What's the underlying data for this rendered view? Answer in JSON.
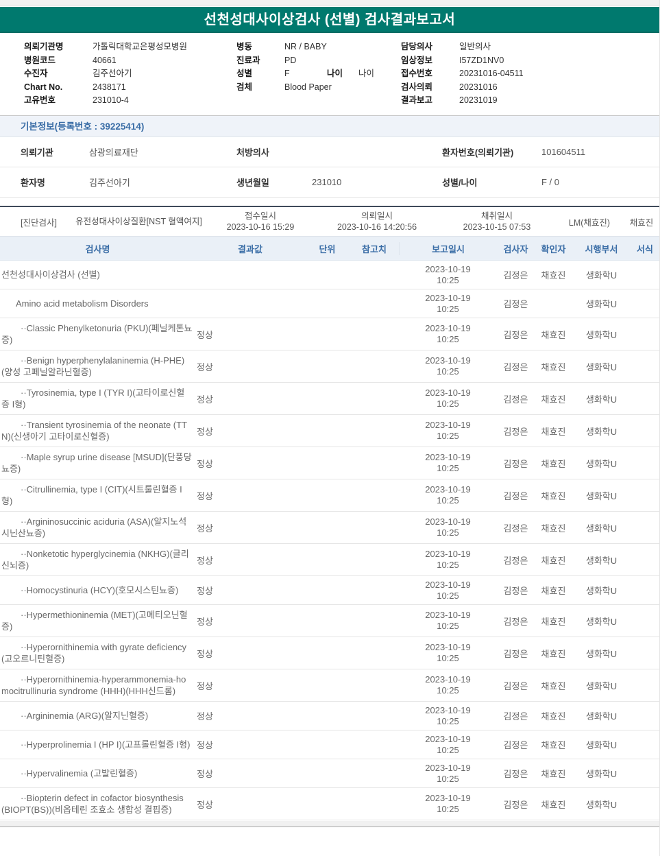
{
  "colors": {
    "banner_teal": "#00796E",
    "accent_blue": "#3A6DA6",
    "table_header_bg": "#EAF0F7",
    "section_header_bg": "#EFF3F9"
  },
  "banner": {
    "title": "선천성대사이상검사 (선별) 검사결과보고서"
  },
  "patient_header": {
    "left": [
      {
        "label": "의뢰기관명",
        "value": "가톨릭대학교은평성모병원"
      },
      {
        "label": "병원코드",
        "value": "40661"
      },
      {
        "label": "수진자",
        "value": "김주선아기"
      },
      {
        "label": "Chart No.",
        "value": "2438171"
      },
      {
        "label": "고유번호",
        "value": "231010-4"
      }
    ],
    "middle": [
      {
        "label": "병동",
        "value": "NR / BABY"
      },
      {
        "label": "진료과",
        "value": "PD"
      },
      {
        "label": "성별",
        "value": "F",
        "extra_label": "나이",
        "extra_value": "나이"
      },
      {
        "label": "검체",
        "value": "Blood Paper"
      }
    ],
    "right": [
      {
        "label": "담당의사",
        "value": "일반의사"
      },
      {
        "label": "임상정보",
        "value": "I57ZD1NV0"
      },
      {
        "label": "접수번호",
        "value": "20231016-04511"
      },
      {
        "label": "검사의뢰",
        "value": "20231016"
      },
      {
        "label": "결과보고",
        "value": "20231019"
      }
    ]
  },
  "basic_info": {
    "section_title": "기본정보(등록번호 : 39225414)",
    "rows": [
      [
        {
          "label": "의뢰기관",
          "value": "삼광의료재단"
        },
        {
          "label": "처방의사",
          "value": ""
        },
        {
          "label": "환자번호(의뢰기관)",
          "value": "101604511"
        }
      ],
      [
        {
          "label": "환자명",
          "value": "김주선아기"
        },
        {
          "label": "생년월일",
          "value": "231010"
        },
        {
          "label": "성별/나이",
          "value": "F / 0"
        }
      ]
    ]
  },
  "diagnosis_bar": {
    "tag": "[진단검사]",
    "group_name": "유전성대사이상질환[NST 혈액여지]",
    "received_label": "접수일시",
    "received_value": "2023-10-16 15:29",
    "requested_label": "의뢰일시",
    "requested_value": "2023-10-16 14:20:56",
    "collected_label": "채취일시",
    "collected_value": "2023-10-15 07:53",
    "lab": "LM(채효진)",
    "collector": "채효진"
  },
  "results_table": {
    "headers": {
      "name": "검사명",
      "result": "결과값",
      "unit": "단위",
      "ref": "참고치",
      "report": "보고일시",
      "tester": "검사자",
      "confirmer": "확인자",
      "dept": "시행부서",
      "form": "서식"
    },
    "rows": [
      {
        "name": "선천성대사이상검사 (선별)",
        "level": 0,
        "result": "",
        "report_date": "2023-10-19",
        "report_time": "10:25",
        "tester": "김정은",
        "confirmer": "채효진",
        "dept": "생화학U"
      },
      {
        "name": "Amino acid metabolism Disorders",
        "level": 1,
        "result": "",
        "report_date": "2023-10-19",
        "report_time": "10:25",
        "tester": "김정은",
        "confirmer": "",
        "dept": "생화학U"
      },
      {
        "name": "··Classic Phenylketonuria (PKU)(페닐케톤뇨증)",
        "level": 2,
        "result": "정상",
        "report_date": "2023-10-19",
        "report_time": "10:25",
        "tester": "김정은",
        "confirmer": "채효진",
        "dept": "생화학U"
      },
      {
        "name": "··Benign hyperphenylalaninemia (H-PHE)(양성 고페닐알라닌혈증)",
        "level": 2,
        "result": "정상",
        "report_date": "2023-10-19",
        "report_time": "10:25",
        "tester": "김정은",
        "confirmer": "채효진",
        "dept": "생화학U"
      },
      {
        "name": "··Tyrosinemia, type I (TYR I)(고타이로신혈증 I형)",
        "level": 2,
        "result": "정상",
        "report_date": "2023-10-19",
        "report_time": "10:25",
        "tester": "김정은",
        "confirmer": "채효진",
        "dept": "생화학U"
      },
      {
        "name": "··Transient tyrosinemia of the neonate (TTN)(신생아기 고타이로신혈증)",
        "level": 2,
        "result": "정상",
        "report_date": "2023-10-19",
        "report_time": "10:25",
        "tester": "김정은",
        "confirmer": "채효진",
        "dept": "생화학U"
      },
      {
        "name": "··Maple syrup urine disease [MSUD](단풍당뇨증)",
        "level": 2,
        "result": "정상",
        "report_date": "2023-10-19",
        "report_time": "10:25",
        "tester": "김정은",
        "confirmer": "채효진",
        "dept": "생화학U"
      },
      {
        "name": "··Citrullinemia, type I (CIT)(시트룰린혈증 I형)",
        "level": 2,
        "result": "정상",
        "report_date": "2023-10-19",
        "report_time": "10:25",
        "tester": "김정은",
        "confirmer": "채효진",
        "dept": "생화학U"
      },
      {
        "name": "··Argininosuccinic aciduria (ASA)(알지노석시닌산뇨증)",
        "level": 2,
        "result": "정상",
        "report_date": "2023-10-19",
        "report_time": "10:25",
        "tester": "김정은",
        "confirmer": "채효진",
        "dept": "생화학U"
      },
      {
        "name": "··Nonketotic hyperglycinemia (NKHG)(글리신뇌증)",
        "level": 2,
        "result": "정상",
        "report_date": "2023-10-19",
        "report_time": "10:25",
        "tester": "김정은",
        "confirmer": "채효진",
        "dept": "생화학U"
      },
      {
        "name": "··Homocystinuria (HCY)(호모시스틴뇨증)",
        "level": 2,
        "result": "정상",
        "report_date": "2023-10-19",
        "report_time": "10:25",
        "tester": "김정은",
        "confirmer": "채효진",
        "dept": "생화학U"
      },
      {
        "name": "··Hypermethioninemia (MET)(고메티오닌혈증)",
        "level": 2,
        "result": "정상",
        "report_date": "2023-10-19",
        "report_time": "10:25",
        "tester": "김정은",
        "confirmer": "채효진",
        "dept": "생화학U"
      },
      {
        "name": "··Hyperornithinemia with gyrate deficiency(고오르니틴혈증)",
        "level": 2,
        "result": "정상",
        "report_date": "2023-10-19",
        "report_time": "10:25",
        "tester": "김정은",
        "confirmer": "채효진",
        "dept": "생화학U"
      },
      {
        "name": "··Hyperornithinemia-hyperammonemia-homocitrullinuria syndrome (HHH)(HHH신드롬)",
        "level": 2,
        "result": "정상",
        "report_date": "2023-10-19",
        "report_time": "10:25",
        "tester": "김정은",
        "confirmer": "채효진",
        "dept": "생화학U"
      },
      {
        "name": "··Argininemia (ARG)(알지닌혈증)",
        "level": 2,
        "result": "정상",
        "report_date": "2023-10-19",
        "report_time": "10:25",
        "tester": "김정은",
        "confirmer": "채효진",
        "dept": "생화학U"
      },
      {
        "name": "··Hyperprolinemia I (HP I)(고프롤린혈증 I형)",
        "level": 2,
        "result": "정상",
        "report_date": "2023-10-19",
        "report_time": "10:25",
        "tester": "김정은",
        "confirmer": "채효진",
        "dept": "생화학U"
      },
      {
        "name": "··Hypervalinemia (고발린혈증)",
        "level": 2,
        "result": "정상",
        "report_date": "2023-10-19",
        "report_time": "10:25",
        "tester": "김정은",
        "confirmer": "채효진",
        "dept": "생화학U"
      },
      {
        "name": "··Biopterin defect in cofactor biosynthesis (BIOPT(BS))(비옵테린 조효소 생합성 결핍증)",
        "level": 2,
        "result": "정상",
        "report_date": "2023-10-19",
        "report_time": "10:25",
        "tester": "김정은",
        "confirmer": "채효진",
        "dept": "생화학U"
      }
    ]
  }
}
